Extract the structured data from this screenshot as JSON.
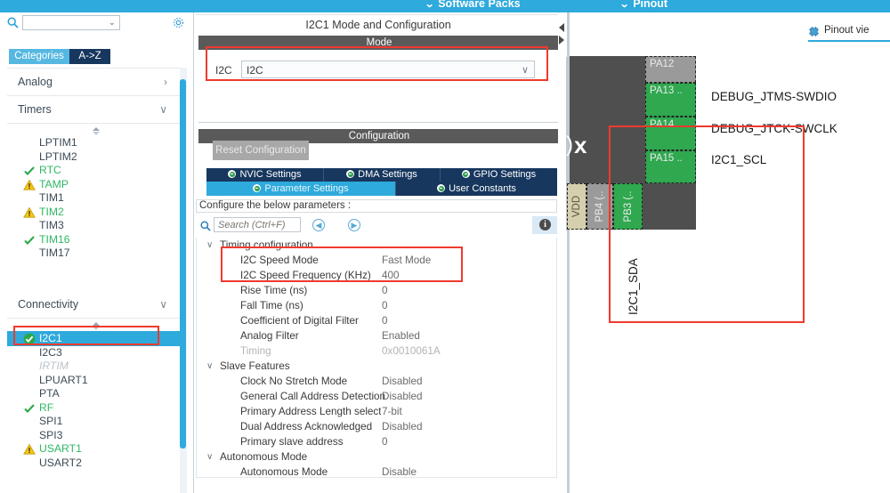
{
  "topbar": {
    "items": [
      {
        "label": "Software Packs",
        "icon": "chevron-down-icon"
      },
      {
        "label": "Pinout",
        "icon": "chevron-down-icon"
      }
    ]
  },
  "sidebar": {
    "search": {
      "value": "",
      "placeholder": ""
    },
    "search_icon": "search-icon",
    "gear_icon": "gear-icon",
    "tabs": [
      {
        "label": "Categories",
        "active": true
      },
      {
        "label": "A->Z",
        "active": false
      }
    ],
    "categories": [
      {
        "label": "Analog",
        "chevron": "›",
        "expanded": false
      },
      {
        "label": "Timers",
        "chevron": "∨",
        "expanded": true
      }
    ],
    "timers_items": [
      {
        "label": "LPTIM1",
        "status": "none"
      },
      {
        "label": "LPTIM2",
        "status": "none"
      },
      {
        "label": "RTC",
        "status": "check"
      },
      {
        "label": "TAMP",
        "status": "warn"
      },
      {
        "label": "TIM1",
        "status": "none"
      },
      {
        "label": "TIM2",
        "status": "warn"
      },
      {
        "label": "TIM3",
        "status": "none"
      },
      {
        "label": "TIM16",
        "status": "check"
      },
      {
        "label": "TIM17",
        "status": "none"
      }
    ],
    "connectivity": {
      "label": "Connectivity",
      "chevron": "∨"
    },
    "connectivity_items": [
      {
        "label": "I2C1",
        "status": "configured",
        "selected": true
      },
      {
        "label": "I2C3",
        "status": "none"
      },
      {
        "label": "IRTIM",
        "status": "disabled"
      },
      {
        "label": "LPUART1",
        "status": "none"
      },
      {
        "label": "PTA",
        "status": "none"
      },
      {
        "label": "RF",
        "status": "check"
      },
      {
        "label": "SPI1",
        "status": "none"
      },
      {
        "label": "SPI3",
        "status": "none"
      },
      {
        "label": "USART1",
        "status": "warn"
      },
      {
        "label": "USART2",
        "status": "none"
      }
    ]
  },
  "center": {
    "panel_title": "I2C1 Mode and Configuration",
    "mode_bar": "Mode",
    "mode": {
      "label": "I2C",
      "value": "I2C",
      "chevron": "∨"
    },
    "config_bar": "Configuration",
    "reset_button": "Reset Configuration",
    "tabs_row1": [
      {
        "label": "NVIC Settings",
        "active": false
      },
      {
        "label": "DMA Settings",
        "active": false
      },
      {
        "label": "GPIO Settings",
        "active": false
      }
    ],
    "tabs_row2": [
      {
        "label": "Parameter Settings",
        "active": true
      },
      {
        "label": "User Constants",
        "active": false
      }
    ],
    "note": "Configure the below parameters :",
    "search": {
      "value": "",
      "placeholder": "Search (Ctrl+F)"
    },
    "nav_prev_icon": "chevron-left-circle-icon",
    "nav_next_icon": "chevron-right-circle-icon",
    "info_icon": "info-icon",
    "params": [
      {
        "group": "Timing configuration",
        "chevron": "∨",
        "rows": [
          {
            "name": "I2C Speed Mode",
            "value": "Fast Mode",
            "disabled": false
          },
          {
            "name": "I2C Speed Frequency (KHz)",
            "value": "400",
            "disabled": false
          },
          {
            "name": "Rise Time (ns)",
            "value": "0",
            "disabled": false
          },
          {
            "name": "Fall Time (ns)",
            "value": "0",
            "disabled": false
          },
          {
            "name": "Coefficient of Digital Filter",
            "value": "0",
            "disabled": false
          },
          {
            "name": "Analog Filter",
            "value": "Enabled",
            "disabled": false
          },
          {
            "name": "Timing",
            "value": "0x0010061A",
            "disabled": true
          }
        ]
      },
      {
        "group": "Slave Features",
        "chevron": "∨",
        "rows": [
          {
            "name": "Clock No Stretch Mode",
            "value": "Disabled",
            "disabled": false
          },
          {
            "name": "General Call Address Detection",
            "value": "Disabled",
            "disabled": false
          },
          {
            "name": "Primary Address Length selectio.",
            "value": "7-bit",
            "disabled": false
          },
          {
            "name": "Dual Address Acknowledged",
            "value": "Disabled",
            "disabled": false
          },
          {
            "name": "Primary slave address",
            "value": "0",
            "disabled": false
          }
        ]
      },
      {
        "group": "Autonomous Mode",
        "chevron": "∨",
        "rows": [
          {
            "name": "Autonomous Mode",
            "value": "Disable",
            "disabled": false
          }
        ]
      }
    ]
  },
  "pinout": {
    "view_link": "Pinout vie",
    "view_icon": "chip-icon",
    "chip_label": "x",
    "pins_right": [
      {
        "label": "PA12",
        "color": "gray"
      },
      {
        "label": "PA13 ..",
        "color": "green"
      },
      {
        "label": "PA14 ..",
        "color": "green"
      },
      {
        "label": "PA15 ..",
        "color": "green"
      }
    ],
    "pins_bottom": [
      {
        "label": "VDD",
        "color": "tan"
      },
      {
        "label": "PB4 (..",
        "color": "gray"
      },
      {
        "label": "PB3 (..",
        "color": "green"
      }
    ],
    "net_labels": [
      {
        "text": "DEBUG_JTMS-SWDIO"
      },
      {
        "text": "DEBUG_JTCK-SWCLK"
      },
      {
        "text": "I2C1_SCL"
      }
    ],
    "net_vertical": "I2C1_SDA"
  },
  "highlights": {
    "color": "#f03a2e",
    "regions": [
      "mode-combo",
      "i2c-speed-params",
      "sidebar-i2c1",
      "pinout-sda"
    ]
  }
}
